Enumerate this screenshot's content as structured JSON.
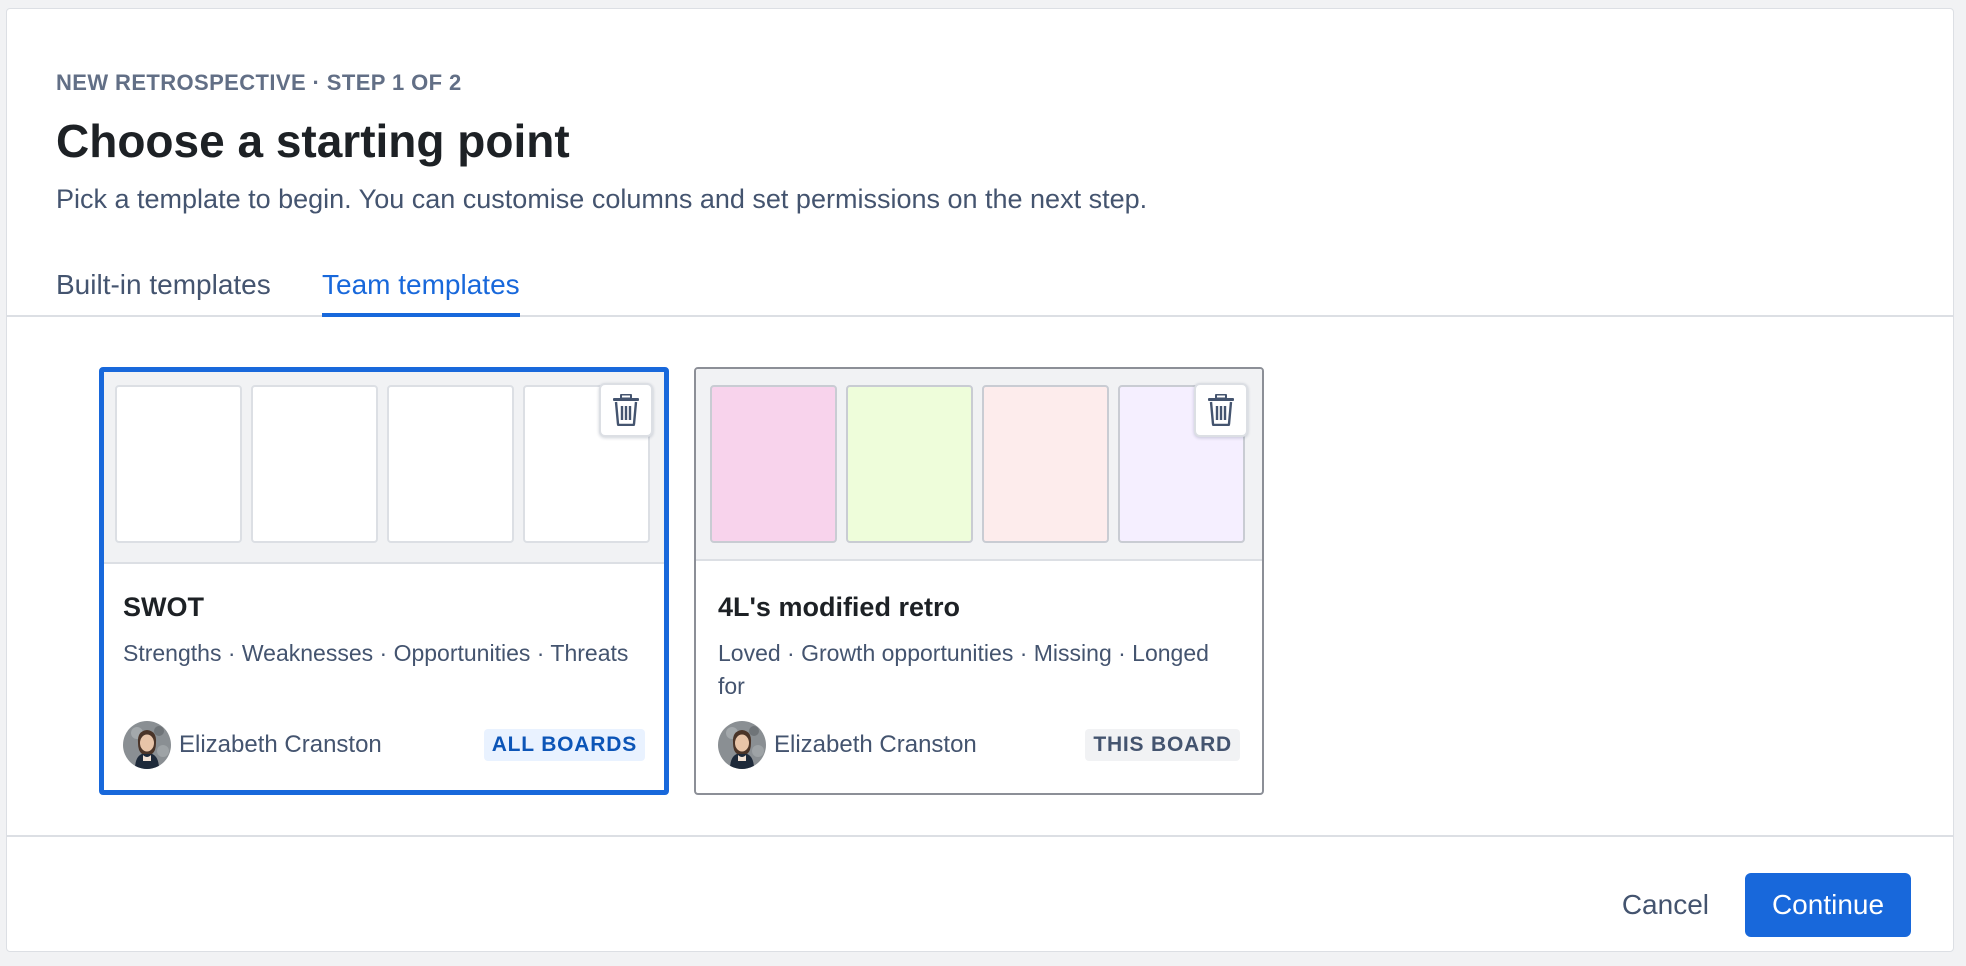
{
  "dialog": {
    "eyebrow": "NEW RETROSPECTIVE · STEP 1 OF 2",
    "title": "Choose a starting point",
    "subtitle": "Pick a template to begin. You can customise columns and set permissions on the next step."
  },
  "tabs": [
    {
      "label": "Built-in templates",
      "active": false
    },
    {
      "label": "Team templates",
      "active": true
    }
  ],
  "templates": [
    {
      "name": "SWOT",
      "columns": "Strengths · Weaknesses · Opportunities · Threats",
      "author": "Elizabeth Cranston",
      "scope": "ALL BOARDS",
      "selected": true,
      "swatch_colors": [
        "#ffffff",
        "#ffffff",
        "#ffffff",
        "#ffffff"
      ],
      "delete_icon": "trash-icon"
    },
    {
      "name": "4L's modified retro",
      "columns": "Loved · Growth opportunities · Missing · Longed for",
      "author": "Elizabeth Cranston",
      "scope": "THIS BOARD",
      "selected": false,
      "swatch_colors": [
        "#f8d3ec",
        "#eefdda",
        "#fdecec",
        "#f5efff"
      ],
      "delete_icon": "trash-icon"
    }
  ],
  "footer": {
    "cancel_label": "Cancel",
    "continue_label": "Continue"
  },
  "colors": {
    "accent": "#1868db",
    "badge_all_bg": "#e9f2ff",
    "badge_this_bg": "#f1f2f4"
  }
}
